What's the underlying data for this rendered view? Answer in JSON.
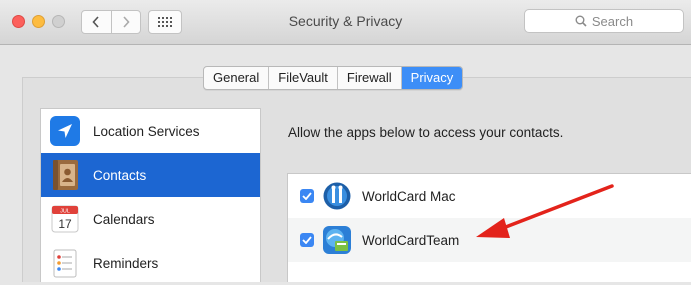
{
  "window": {
    "title": "Security & Privacy",
    "search_placeholder": "Search"
  },
  "tabs": [
    {
      "label": "General",
      "active": false
    },
    {
      "label": "FileVault",
      "active": false
    },
    {
      "label": "Firewall",
      "active": false
    },
    {
      "label": "Privacy",
      "active": true
    }
  ],
  "sidebar": {
    "items": [
      {
        "label": "Location Services",
        "icon": "location-arrow-icon",
        "selected": false
      },
      {
        "label": "Contacts",
        "icon": "contacts-book-icon",
        "selected": true
      },
      {
        "label": "Calendars",
        "icon": "calendar-icon",
        "selected": false,
        "calendar_month": "JUL",
        "calendar_day": "17"
      },
      {
        "label": "Reminders",
        "icon": "reminders-list-icon",
        "selected": false
      }
    ]
  },
  "privacy": {
    "description": "Allow the apps below to access your contacts.",
    "apps": [
      {
        "name": "WorldCard Mac",
        "checked": true,
        "icon": "worldcard-mac-icon"
      },
      {
        "name": "WorldCardTeam",
        "checked": true,
        "icon": "worldcard-team-icon"
      }
    ]
  },
  "annotation": {
    "arrow_color": "#e3231b"
  },
  "colors": {
    "accent": "#3d8ef7",
    "selection": "#1c66d2"
  }
}
